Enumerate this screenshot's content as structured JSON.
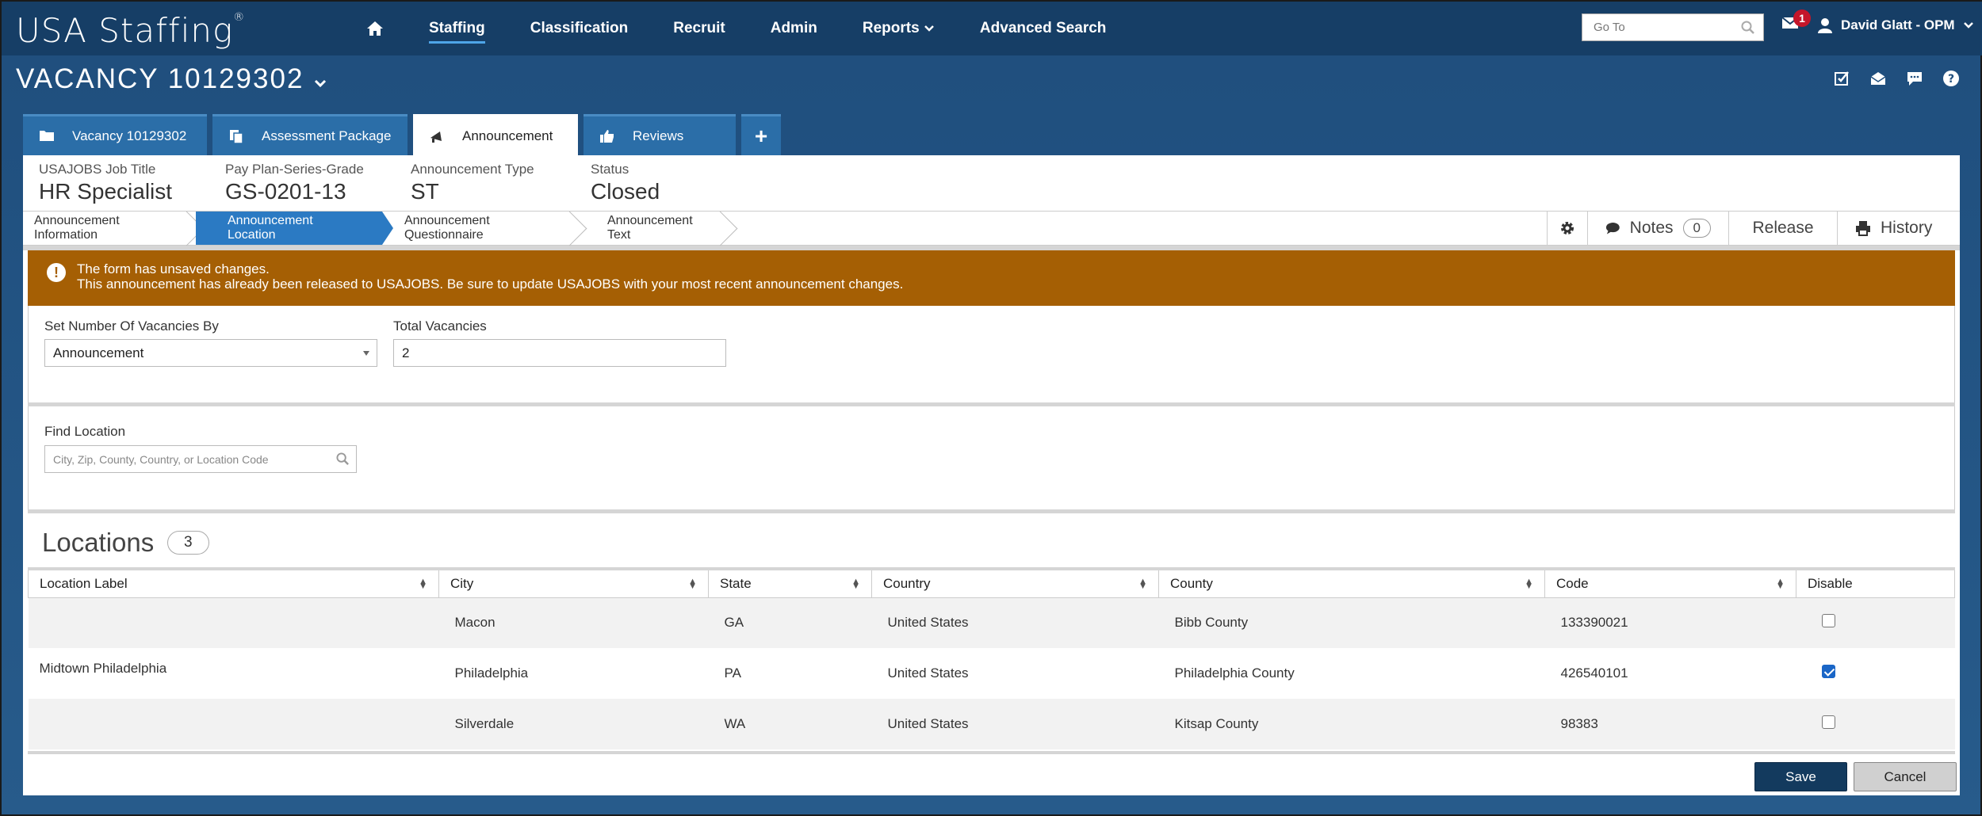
{
  "app": {
    "brand": "USA Staffing",
    "brand_mark": "®"
  },
  "nav": {
    "items": [
      {
        "label": "Staffing",
        "active": true
      },
      {
        "label": "Classification"
      },
      {
        "label": "Recruit"
      },
      {
        "label": "Admin"
      },
      {
        "label": "Reports"
      },
      {
        "label": "Advanced Search"
      }
    ],
    "goto_placeholder": "Go To",
    "mail_count": "1",
    "user_name": "David Glatt - OPM"
  },
  "vacancy": {
    "title": "VACANCY 10129302"
  },
  "tabs": [
    {
      "label": "Vacancy 10129302"
    },
    {
      "label": "Assessment Package"
    },
    {
      "label": "Announcement",
      "active": true
    },
    {
      "label": "Reviews"
    },
    {
      "label": "+"
    }
  ],
  "summary": {
    "job_title_label": "USAJOBS Job Title",
    "job_title": "HR Specialist",
    "ppsg_label": "Pay Plan-Series-Grade",
    "ppsg": "GS-0201-13",
    "type_label": "Announcement Type",
    "type": "ST",
    "status_label": "Status",
    "status": "Closed"
  },
  "steps": [
    {
      "label": "Announcement Information"
    },
    {
      "label": "Announcement Location",
      "active": true
    },
    {
      "label": "Announcement Questionnaire"
    },
    {
      "label": "Announcement Text"
    }
  ],
  "actions": {
    "notes": "Notes",
    "notes_count": "0",
    "release": "Release",
    "history": "History"
  },
  "alert": {
    "line1": "The form has unsaved changes.",
    "line2": "This announcement has already been released to USAJOBS. Be sure to update USAJOBS with your most recent announcement changes.",
    "color": "#a55f04"
  },
  "form": {
    "set_by_label": "Set Number Of Vacancies By",
    "set_by_value": "Announcement",
    "total_label": "Total Vacancies",
    "total_value": "2",
    "find_label": "Find Location",
    "find_placeholder": "City, Zip, County, Country, or Location Code"
  },
  "locations": {
    "title": "Locations",
    "count": "3",
    "columns": [
      "Location Label",
      "City",
      "State",
      "Country",
      "County",
      "Code",
      "Disable"
    ],
    "rows": [
      {
        "label": "",
        "city": "Macon",
        "state": "GA",
        "country": "United States",
        "county": "Bibb County",
        "code": "133390021",
        "disabled": false
      },
      {
        "label": "Midtown Philadelphia",
        "city": "Philadelphia",
        "state": "PA",
        "country": "United States",
        "county": "Philadelphia County",
        "code": "426540101",
        "disabled": true
      },
      {
        "label": "",
        "city": "Silverdale",
        "state": "WA",
        "country": "United States",
        "county": "Kitsap County",
        "code": "98383",
        "disabled": false
      }
    ]
  },
  "buttons": {
    "save": "Save",
    "cancel": "Cancel"
  }
}
